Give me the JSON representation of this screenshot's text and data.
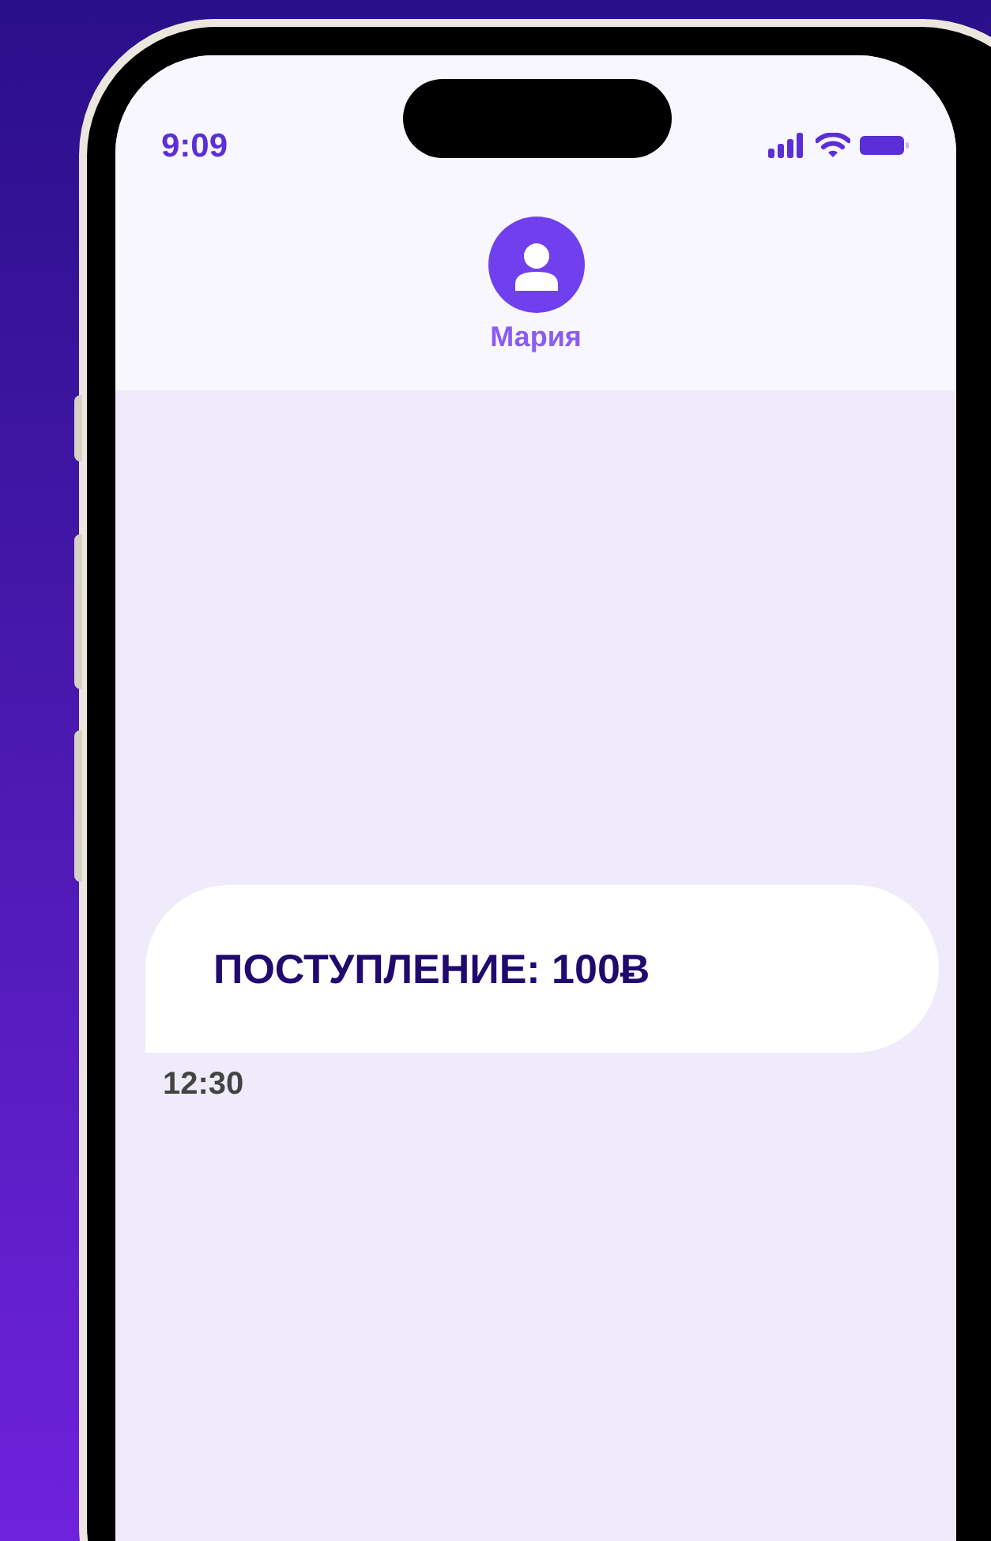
{
  "status_bar": {
    "time": "9:09"
  },
  "contact": {
    "name": "Мария"
  },
  "messages": [
    {
      "text": "ПОСТУПЛЕНИЕ: 100Ƀ",
      "time": "12:30"
    }
  ]
}
